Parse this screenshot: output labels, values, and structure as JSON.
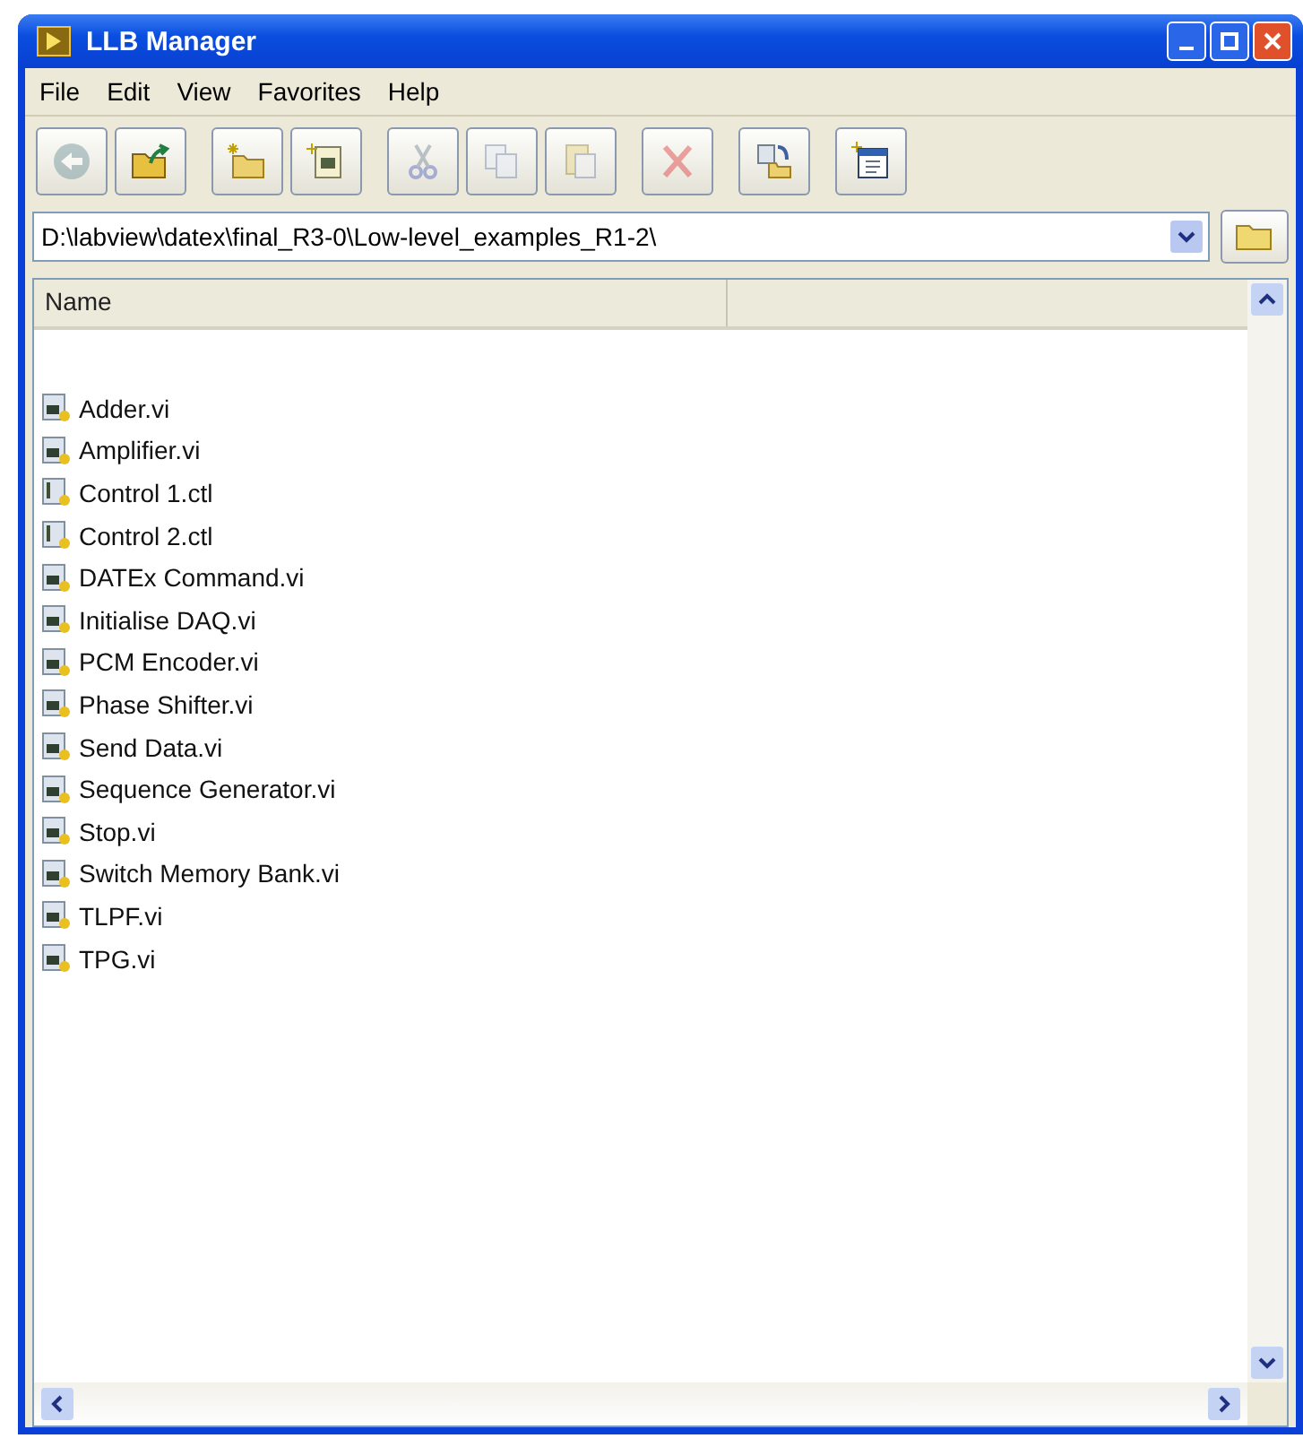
{
  "window": {
    "title": "LLB Manager"
  },
  "menu": [
    "File",
    "Edit",
    "View",
    "Favorites",
    "Help"
  ],
  "toolbar": [
    {
      "kind": "back",
      "disabled": true
    },
    {
      "kind": "up",
      "disabled": false
    },
    {
      "kind": "newfolder",
      "disabled": false
    },
    {
      "kind": "newfile",
      "disabled": false
    },
    {
      "kind": "cut",
      "disabled": true
    },
    {
      "kind": "copy",
      "disabled": true
    },
    {
      "kind": "paste",
      "disabled": true
    },
    {
      "kind": "delete",
      "disabled": true
    },
    {
      "kind": "move",
      "disabled": false
    },
    {
      "kind": "properties",
      "disabled": false
    }
  ],
  "address": {
    "value": "D:\\labview\\datex\\final_R3-0\\Low-level_examples_R1-2\\"
  },
  "list": {
    "columns": [
      "Name"
    ],
    "items": [
      {
        "name": "Adder.vi",
        "kind": "vi"
      },
      {
        "name": "Amplifier.vi",
        "kind": "vi"
      },
      {
        "name": "Control 1.ctl",
        "kind": "ctl"
      },
      {
        "name": "Control 2.ctl",
        "kind": "ctl"
      },
      {
        "name": "DATEx Command.vi",
        "kind": "vi"
      },
      {
        "name": "Initialise DAQ.vi",
        "kind": "vi"
      },
      {
        "name": "PCM Encoder.vi",
        "kind": "vi"
      },
      {
        "name": "Phase Shifter.vi",
        "kind": "vi"
      },
      {
        "name": "Send Data.vi",
        "kind": "vi"
      },
      {
        "name": "Sequence Generator.vi",
        "kind": "vi"
      },
      {
        "name": "Stop.vi",
        "kind": "vi"
      },
      {
        "name": "Switch Memory Bank.vi",
        "kind": "vi"
      },
      {
        "name": "TLPF.vi",
        "kind": "vi"
      },
      {
        "name": "TPG.vi",
        "kind": "vi"
      }
    ]
  }
}
